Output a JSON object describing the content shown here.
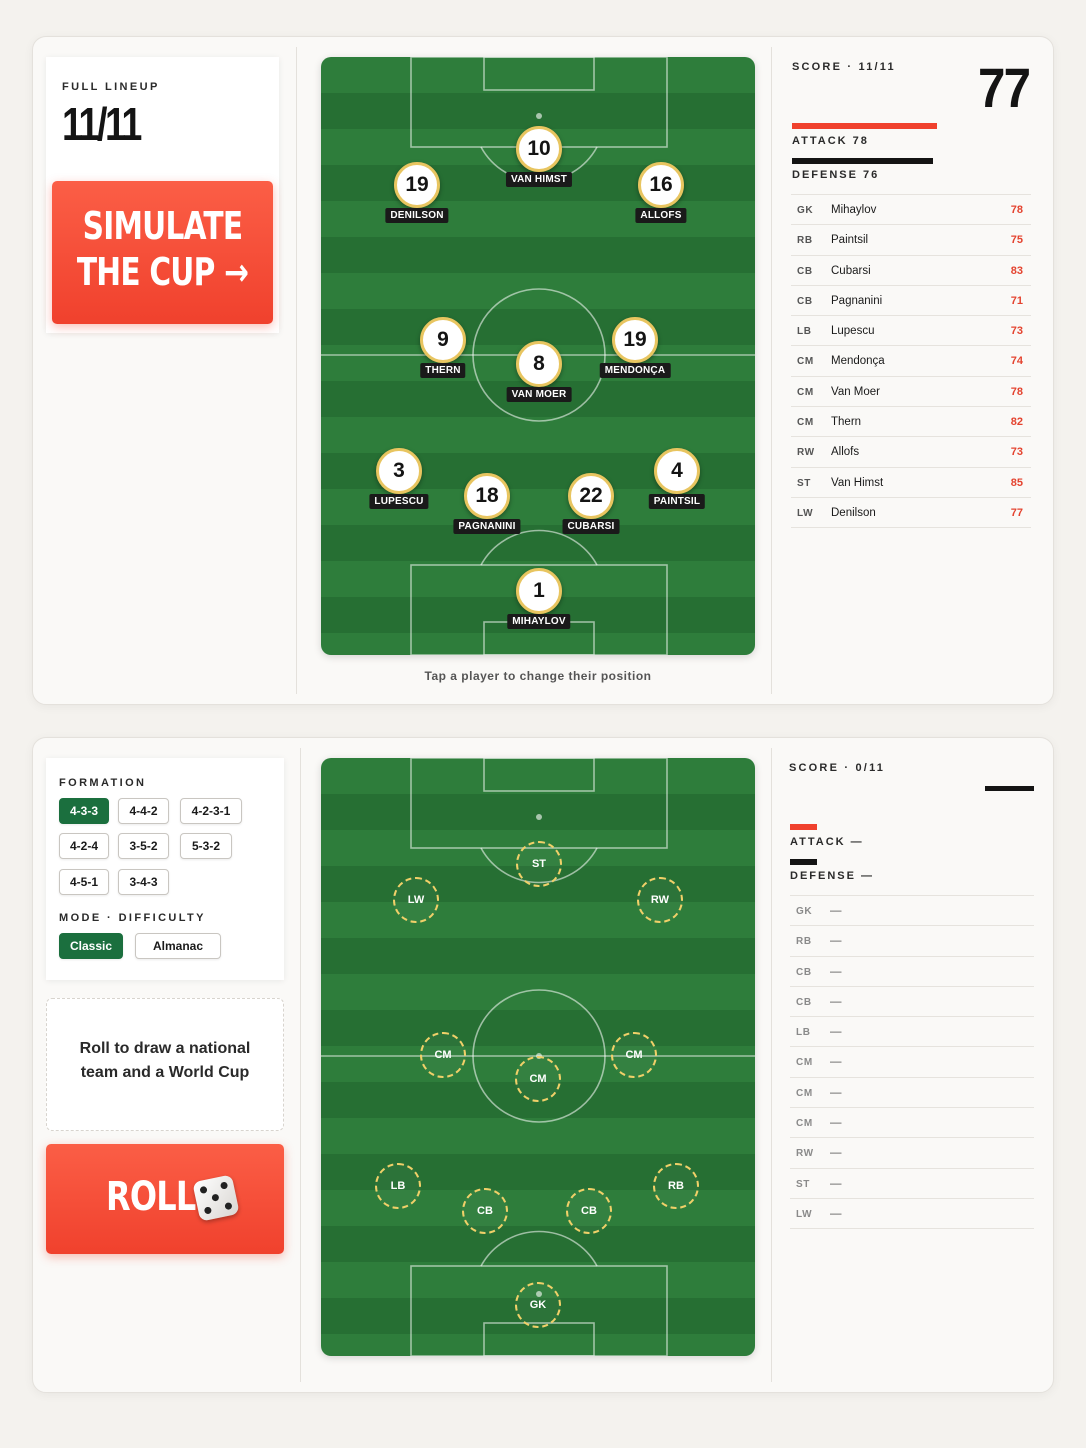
{
  "top": {
    "lineup_label": "FULL LINEUP",
    "lineup_count": "11/11",
    "simulate_line1": "SIMULATE",
    "simulate_line2": "THE CUP →",
    "hint": "Tap a player to change their position",
    "score_label": "SCORE · 11/11",
    "score_value": "77",
    "attack_label": "ATTACK 78",
    "defense_label": "DEFENSE 76",
    "attack_value": 78,
    "defense_value": 76,
    "players": [
      {
        "number": "10",
        "name": "VAN HIMST",
        "pos": "ST"
      },
      {
        "number": "19",
        "name": "DENILSON",
        "pos": "LW"
      },
      {
        "number": "16",
        "name": "ALLOFS",
        "pos": "RW"
      },
      {
        "number": "9",
        "name": "THERN",
        "pos": "CM"
      },
      {
        "number": "8",
        "name": "VAN MOER",
        "pos": "CM"
      },
      {
        "number": "19",
        "name": "MENDONÇA",
        "pos": "CM"
      },
      {
        "number": "3",
        "name": "LUPESCU",
        "pos": "LB"
      },
      {
        "number": "18",
        "name": "PAGNANINI",
        "pos": "CB"
      },
      {
        "number": "22",
        "name": "CUBARSI",
        "pos": "CB"
      },
      {
        "number": "4",
        "name": "PAINTSIL",
        "pos": "RB"
      },
      {
        "number": "1",
        "name": "MIHAYLOV",
        "pos": "GK"
      }
    ],
    "ratings": [
      {
        "pos": "GK",
        "name": "Mihaylov",
        "rating": "78"
      },
      {
        "pos": "RB",
        "name": "Paintsil",
        "rating": "75"
      },
      {
        "pos": "CB",
        "name": "Cubarsi",
        "rating": "83"
      },
      {
        "pos": "CB",
        "name": "Pagnanini",
        "rating": "71"
      },
      {
        "pos": "LB",
        "name": "Lupescu",
        "rating": "73"
      },
      {
        "pos": "CM",
        "name": "Mendonça",
        "rating": "74"
      },
      {
        "pos": "CM",
        "name": "Van Moer",
        "rating": "78"
      },
      {
        "pos": "CM",
        "name": "Thern",
        "rating": "82"
      },
      {
        "pos": "RW",
        "name": "Allofs",
        "rating": "73"
      },
      {
        "pos": "ST",
        "name": "Van Himst",
        "rating": "85"
      },
      {
        "pos": "LW",
        "name": "Denilson",
        "rating": "77"
      }
    ]
  },
  "bottom": {
    "formation_label": "FORMATION",
    "formations": [
      "4-3-3",
      "4-4-2",
      "4-2-3-1",
      "4-2-4",
      "3-5-2",
      "5-3-2",
      "4-5-1",
      "3-4-3"
    ],
    "formation_selected": "4-3-3",
    "mode_label": "MODE · DIFFICULTY",
    "modes": [
      "Classic",
      "Almanac"
    ],
    "mode_selected": "Classic",
    "roll_message": "Roll to draw a national team and a World Cup",
    "roll_label": "ROLL",
    "score_label": "SCORE · 0/11",
    "score_value": "",
    "attack_label": "ATTACK —",
    "defense_label": "DEFENSE —",
    "slots": [
      "ST",
      "LW",
      "RW",
      "CM",
      "CM",
      "CM",
      "LB",
      "CB",
      "CB",
      "RB",
      "GK"
    ],
    "ratings": [
      {
        "pos": "GK",
        "name": "—"
      },
      {
        "pos": "RB",
        "name": "—"
      },
      {
        "pos": "CB",
        "name": "—"
      },
      {
        "pos": "CB",
        "name": "—"
      },
      {
        "pos": "LB",
        "name": "—"
      },
      {
        "pos": "CM",
        "name": "—"
      },
      {
        "pos": "CM",
        "name": "—"
      },
      {
        "pos": "CM",
        "name": "—"
      },
      {
        "pos": "RW",
        "name": "—"
      },
      {
        "pos": "ST",
        "name": "—"
      },
      {
        "pos": "LW",
        "name": "—"
      }
    ]
  },
  "colors": {
    "accent": "#f0412d",
    "pitch_green": "#2e7d3b",
    "active_green": "#1b6f3e",
    "rating_red": "#e4432f",
    "disc_border": "#e8c560"
  }
}
